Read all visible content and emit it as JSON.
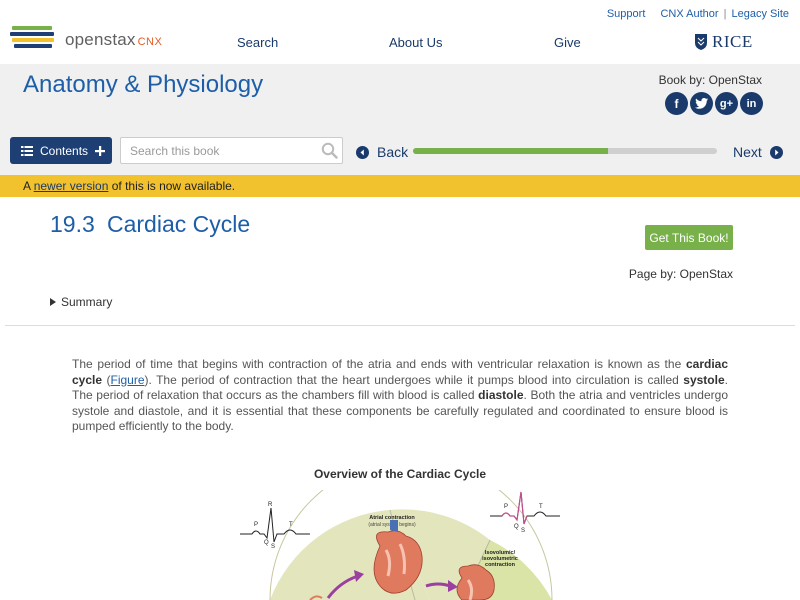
{
  "header": {
    "logo_text": "openstax",
    "logo_suffix": "CNX",
    "util_links": [
      "Support",
      "CNX Author",
      "Legacy Site"
    ],
    "nav": [
      "Search",
      "About Us",
      "Give"
    ],
    "partner": "RICE"
  },
  "book": {
    "title": "Anatomy & Physiology",
    "book_by": "Book by: OpenStax",
    "socials": [
      "facebook-icon",
      "twitter-icon",
      "google-plus-icon",
      "linkedin-icon"
    ]
  },
  "toolbar": {
    "contents_label": "Contents",
    "search_placeholder": "Search this book",
    "back_label": "Back",
    "next_label": "Next",
    "progress": 0.64
  },
  "notice": {
    "prefix": "A",
    "link": "newer version",
    "suffix": "of this is now available."
  },
  "page": {
    "section_number": "19.3",
    "section_title": "Cardiac Cycle",
    "get_book_label": "Get This Book!",
    "page_by": "Page by: OpenStax",
    "summary_label": "Summary"
  },
  "content": {
    "p1": "The period of time that begins with contraction of the atria and ends with ventricular relaxation is known as the ",
    "t1": "cardiac cycle",
    "p2": " (",
    "link": "Figure",
    "p3": "). The period of contraction that the heart undergoes while it pumps blood into circulation is called ",
    "t2": "systole",
    "p4": ". The period of relaxation that occurs as the chambers fill with blood is called ",
    "t3": "diastole",
    "p5": ". Both the atria and ventricles undergo systole and diastole, and it is essential that these components be carefully regulated and coordinated to ensure blood is pumped efficiently to the body."
  },
  "figure": {
    "title": "Overview of the Cardiac Cycle",
    "atrial_label_1": "Atrial contraction",
    "atrial_label_2": "(atrial systole begins)",
    "iso_label_1": "Isovolumic/",
    "iso_label_2": "isovolumetric",
    "iso_label_3": "contraction",
    "ecg_labels": [
      "R",
      "P",
      "T",
      "Q",
      "S"
    ]
  }
}
